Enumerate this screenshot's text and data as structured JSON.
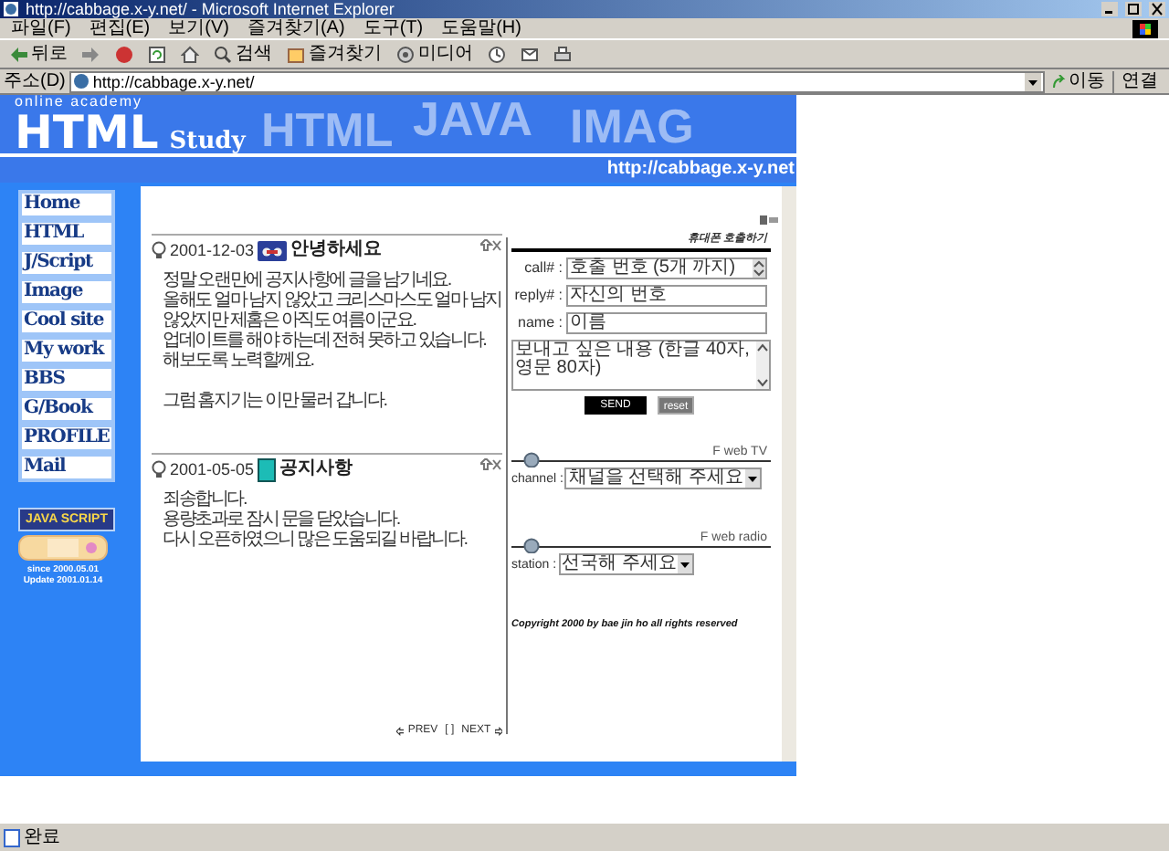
{
  "window": {
    "title": "http://cabbage.x-y.net/ - Microsoft Internet Explorer"
  },
  "menu": [
    "파일(F)",
    "편집(E)",
    "보기(V)",
    "즐겨찾기(A)",
    "도구(T)",
    "도움말(H)"
  ],
  "toolbar": [
    {
      "kind": "back",
      "label": "뒤로"
    },
    {
      "kind": "forward"
    },
    {
      "kind": "stop"
    },
    {
      "kind": "refresh"
    },
    {
      "kind": "home"
    },
    {
      "kind": "search",
      "label": "검색"
    },
    {
      "kind": "favorites",
      "label": "즐겨찾기"
    },
    {
      "kind": "media",
      "label": "미디어"
    },
    {
      "kind": "history"
    },
    {
      "kind": "mail"
    },
    {
      "kind": "print"
    }
  ],
  "address": {
    "label": "주소(D)",
    "url": "http://cabbage.x-y.net/",
    "go": "이동",
    "links": "연결"
  },
  "site": {
    "tagline": "online academy",
    "logo": "HTML",
    "logo_sub": "Study",
    "banner_words": [
      "HTML",
      "JAVA",
      "IMAG"
    ],
    "url": "http://cabbage.x-y.net",
    "nav": [
      "Home",
      "HTML",
      "J/Script",
      "Image",
      "Cool site",
      "My work",
      "BBS",
      "G/Book",
      "PROFILE",
      "Mail"
    ],
    "badge": "JAVA SCRIPT",
    "since": "since 2000.05.01",
    "update": "Update 2001.01.14",
    "posts": [
      {
        "date": "2001-12-03",
        "kind": "tape",
        "title": "안녕하세요",
        "paragraphs": [
          [
            "정말 오랜만에 공지사항에 글을 남기네요.",
            "올해도 얼마 남지 않았고 크리스마스도 얼마 남지",
            "않았지만 제홈은 아직도 여름이군요.",
            "업데이트를 해야 하는데 전혀 못하고 있습니다.",
            "해보도록 노력할께요."
          ],
          [
            "그럼 홈지기는 이만 물러 갑니다."
          ]
        ]
      },
      {
        "date": "2001-05-05",
        "kind": "book",
        "title": "공지사항",
        "paragraphs": [
          [
            "죄송합니다.",
            "용량초과로 잠시 문을 닫았습니다.",
            "다시 오픈하였으니 많은 도움되길 바랍니다."
          ]
        ]
      }
    ],
    "pager": {
      "prev": "PREV",
      "middle": "[ ]",
      "next": "NEXT"
    },
    "pager_form": {
      "heading": "휴대폰 호출하기",
      "fields": [
        {
          "kind": "select",
          "label": "call# :",
          "value": "호출 번호 (5개 까지)"
        },
        {
          "kind": "input",
          "label": "reply# :",
          "value": "자신의 번호"
        },
        {
          "kind": "input",
          "label": "name :",
          "value": "이름"
        },
        {
          "kind": "textarea",
          "value": "보내고 싶은 내용 (한글 40자, 영문 80자)"
        }
      ],
      "send": "SEND",
      "reset": "reset"
    },
    "media": [
      {
        "title": "F web TV",
        "label": "channel :",
        "value": "채널을 선택해 주세요"
      },
      {
        "title": "F web radio",
        "label": "station :",
        "value": "선국해 주세요"
      }
    ],
    "copyright": "Copyright 2000 by bae jin ho all rights reserved"
  },
  "status_bar": {
    "text": "완료"
  }
}
